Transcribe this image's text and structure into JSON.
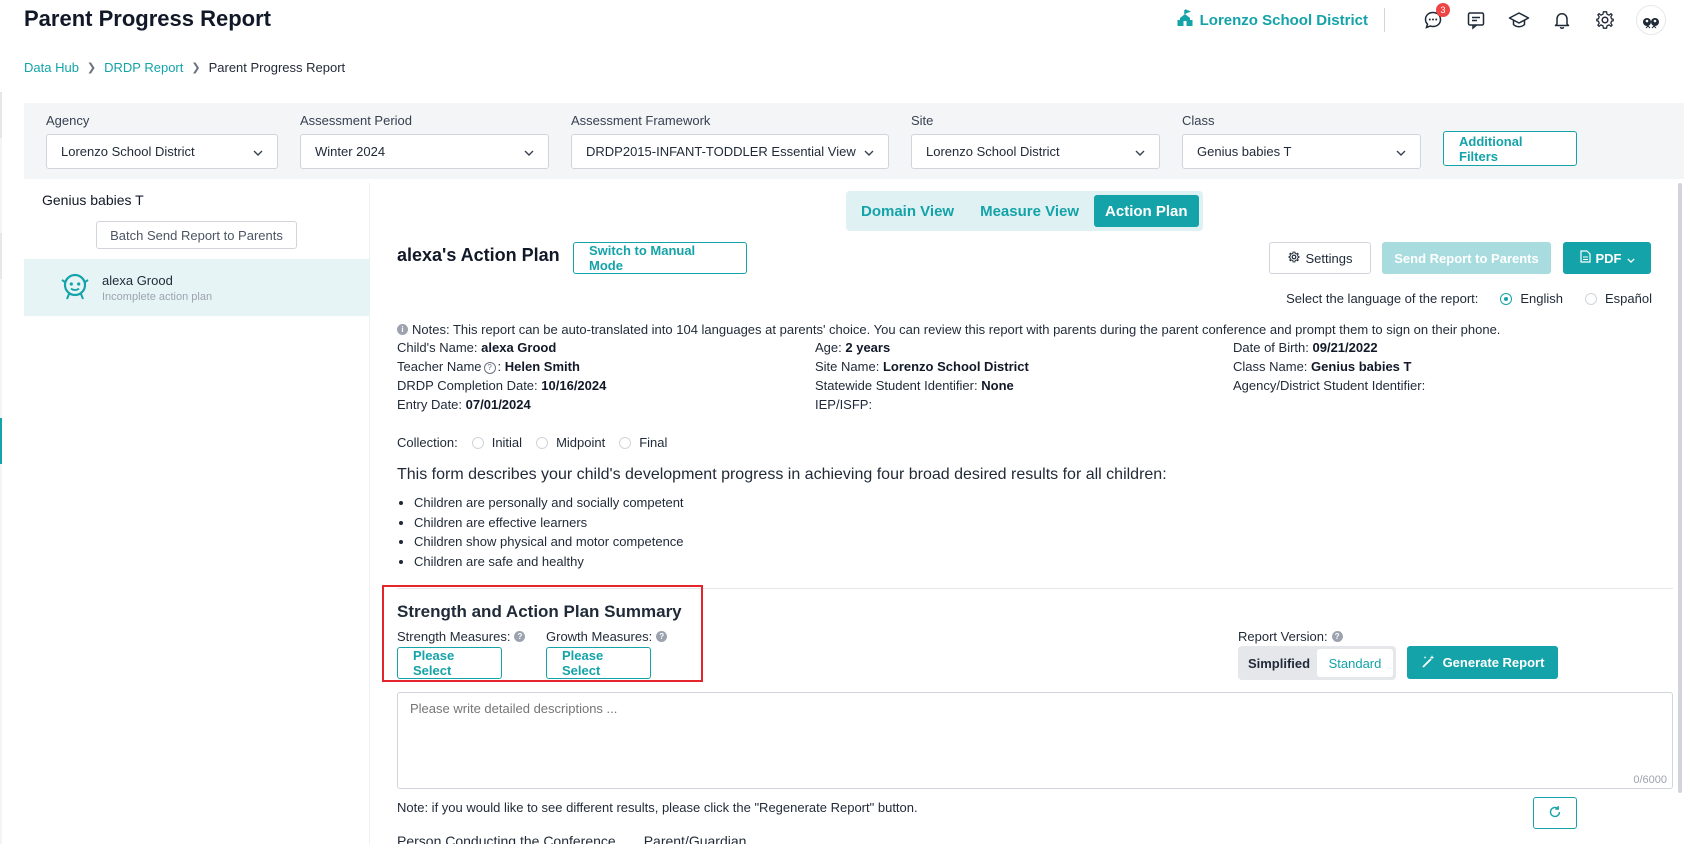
{
  "header": {
    "title": "Parent Progress Report",
    "district": "Lorenzo School District",
    "chat_badge": "3",
    "icons": [
      "school-icon",
      "chat-icon",
      "message-icon",
      "graduation-cap-icon",
      "bell-icon",
      "gear-icon",
      "avatar"
    ]
  },
  "breadcrumb": {
    "items": [
      "Data Hub",
      "DRDP Report"
    ],
    "current": "Parent Progress Report"
  },
  "filters": {
    "agency": {
      "label": "Agency",
      "value": "Lorenzo School District"
    },
    "period": {
      "label": "Assessment Period",
      "value": "Winter 2024"
    },
    "framework": {
      "label": "Assessment Framework",
      "value": "DRDP2015-INFANT-TODDLER Essential View"
    },
    "site": {
      "label": "Site",
      "value": "Lorenzo School District"
    },
    "class": {
      "label": "Class",
      "value": "Genius babies T"
    },
    "additional": "Additional Filters"
  },
  "left_panel": {
    "class_name": "Genius babies T",
    "batch_button": "Batch Send Report to Parents",
    "student": {
      "name": "alexa Grood",
      "status": "Incomplete action plan"
    }
  },
  "view_tabs": [
    {
      "label": "Domain View",
      "active": false
    },
    {
      "label": "Measure View",
      "active": false
    },
    {
      "label": "Action Plan",
      "active": true
    }
  ],
  "action_plan": {
    "title": "alexa's Action Plan",
    "manual_mode": "Switch to Manual Mode",
    "settings": "Settings",
    "send": "Send Report to Parents",
    "pdf": "PDF",
    "language_prompt": "Select the language of the report:",
    "languages": [
      {
        "label": "English",
        "selected": true
      },
      {
        "label": "Español",
        "selected": false
      }
    ],
    "notes": "Notes: This report can be auto-translated into 104 languages at parents' choice. You can review this report with parents during the parent conference and prompt them to sign on their phone."
  },
  "child_info": {
    "child_name_label": "Child's Name:",
    "child_name": "alexa Grood",
    "age_label": "Age:",
    "age": "2 years",
    "dob_label": "Date of Birth:",
    "dob": "09/21/2022",
    "teacher_label": "Teacher Name",
    "teacher": "Helen Smith",
    "site_label": "Site Name:",
    "site": "Lorenzo School District",
    "class_label": "Class Name:",
    "class": "Genius babies T",
    "completion_label": "DRDP Completion Date:",
    "completion": "10/16/2024",
    "ssid_label": "Statewide Student Identifier:",
    "ssid": "None",
    "agency_id_label": "Agency/District Student Identifier:",
    "entry_label": "Entry Date:",
    "entry": "07/01/2024",
    "iep_label": "IEP/ISFP:"
  },
  "collection": {
    "label": "Collection:",
    "options": [
      "Initial",
      "Midpoint",
      "Final"
    ]
  },
  "description": {
    "intro": "This form describes your child's development progress in achieving four broad desired results for all children:",
    "bullets": [
      "Children are personally and socially competent",
      "Children are effective learners",
      "Children show physical and motor competence",
      "Children are safe and healthy"
    ]
  },
  "summary": {
    "title": "Strength and Action Plan Summary",
    "strength_label": "Strength Measures:",
    "growth_label": "Growth Measures:",
    "please_select": "Please Select",
    "report_version_label": "Report Version:",
    "versions": [
      {
        "label": "Simplified",
        "selected": false
      },
      {
        "label": "Standard",
        "selected": true
      }
    ],
    "generate": "Generate Report",
    "placeholder": "Please write detailed descriptions ...",
    "counter": "0/6000",
    "note": "Note: if you would like to see different results, please click the \"Regenerate Report\" button.",
    "conference_label": "Person Conducting the Conference",
    "parent_label": "Parent/Guardian"
  },
  "colors": {
    "accent": "#14a3a9",
    "highlight": "#e4262c",
    "badge": "#ef4444"
  }
}
